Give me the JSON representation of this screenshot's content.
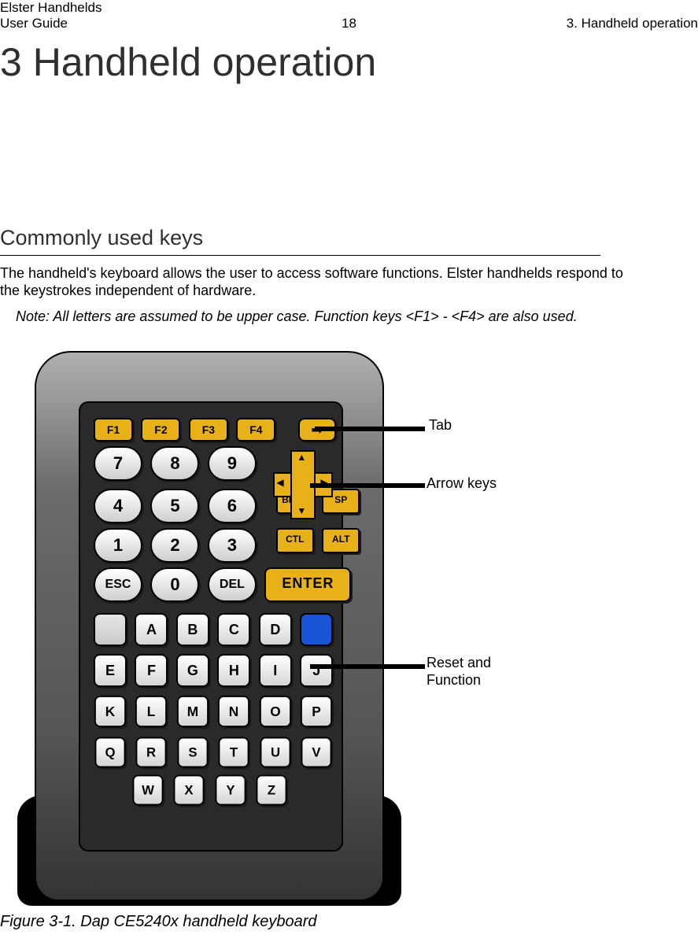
{
  "header": {
    "left1": "Elster Handhelds",
    "left2": "User Guide",
    "center": "18",
    "right": "3. Handheld operation"
  },
  "chapter_title": "3  Handheld operation",
  "section_title": "Commonly used keys",
  "body_p1": "The handheld's keyboard allows the user to access software functions. Elster handhelds respond to the keystrokes independent of hardware.",
  "note": "Note: All letters are assumed to be upper case. Function keys <F1> - <F4> are also used.",
  "callouts": {
    "tab": "Tab",
    "arrows": "Arrow keys",
    "reset1": "Reset and",
    "reset2": "Function"
  },
  "keys": {
    "f": [
      "F1",
      "F2",
      "F3",
      "F4"
    ],
    "tab_glyph": "➟",
    "nums": {
      "r1": [
        "7",
        "8",
        "9"
      ],
      "r2": [
        "4",
        "5",
        "6"
      ],
      "r3": [
        "1",
        "2",
        "3"
      ]
    },
    "dpad": {
      "up": "▲",
      "down": "▼",
      "left": "◀",
      "right": "▶"
    },
    "bksp": "BKSP",
    "sp": "SP",
    "ctl": "CTL",
    "alt": "ALT",
    "esc": "ESC",
    "zero": "0",
    "del": "DEL",
    "enter": "ENTER",
    "letters": {
      "r1b": "",
      "r1": [
        "A",
        "B",
        "C",
        "D"
      ],
      "r1_blue": "",
      "r2": [
        "E",
        "F",
        "G",
        "H",
        "I",
        "J"
      ],
      "r3": [
        "K",
        "L",
        "M",
        "N",
        "O",
        "P"
      ],
      "r4": [
        "Q",
        "R",
        "S",
        "T",
        "U",
        "V"
      ],
      "r5": [
        "W",
        "X",
        "Y",
        "Z"
      ]
    }
  },
  "caption": "Figure 3-1. Dap CE5240x handheld keyboard"
}
